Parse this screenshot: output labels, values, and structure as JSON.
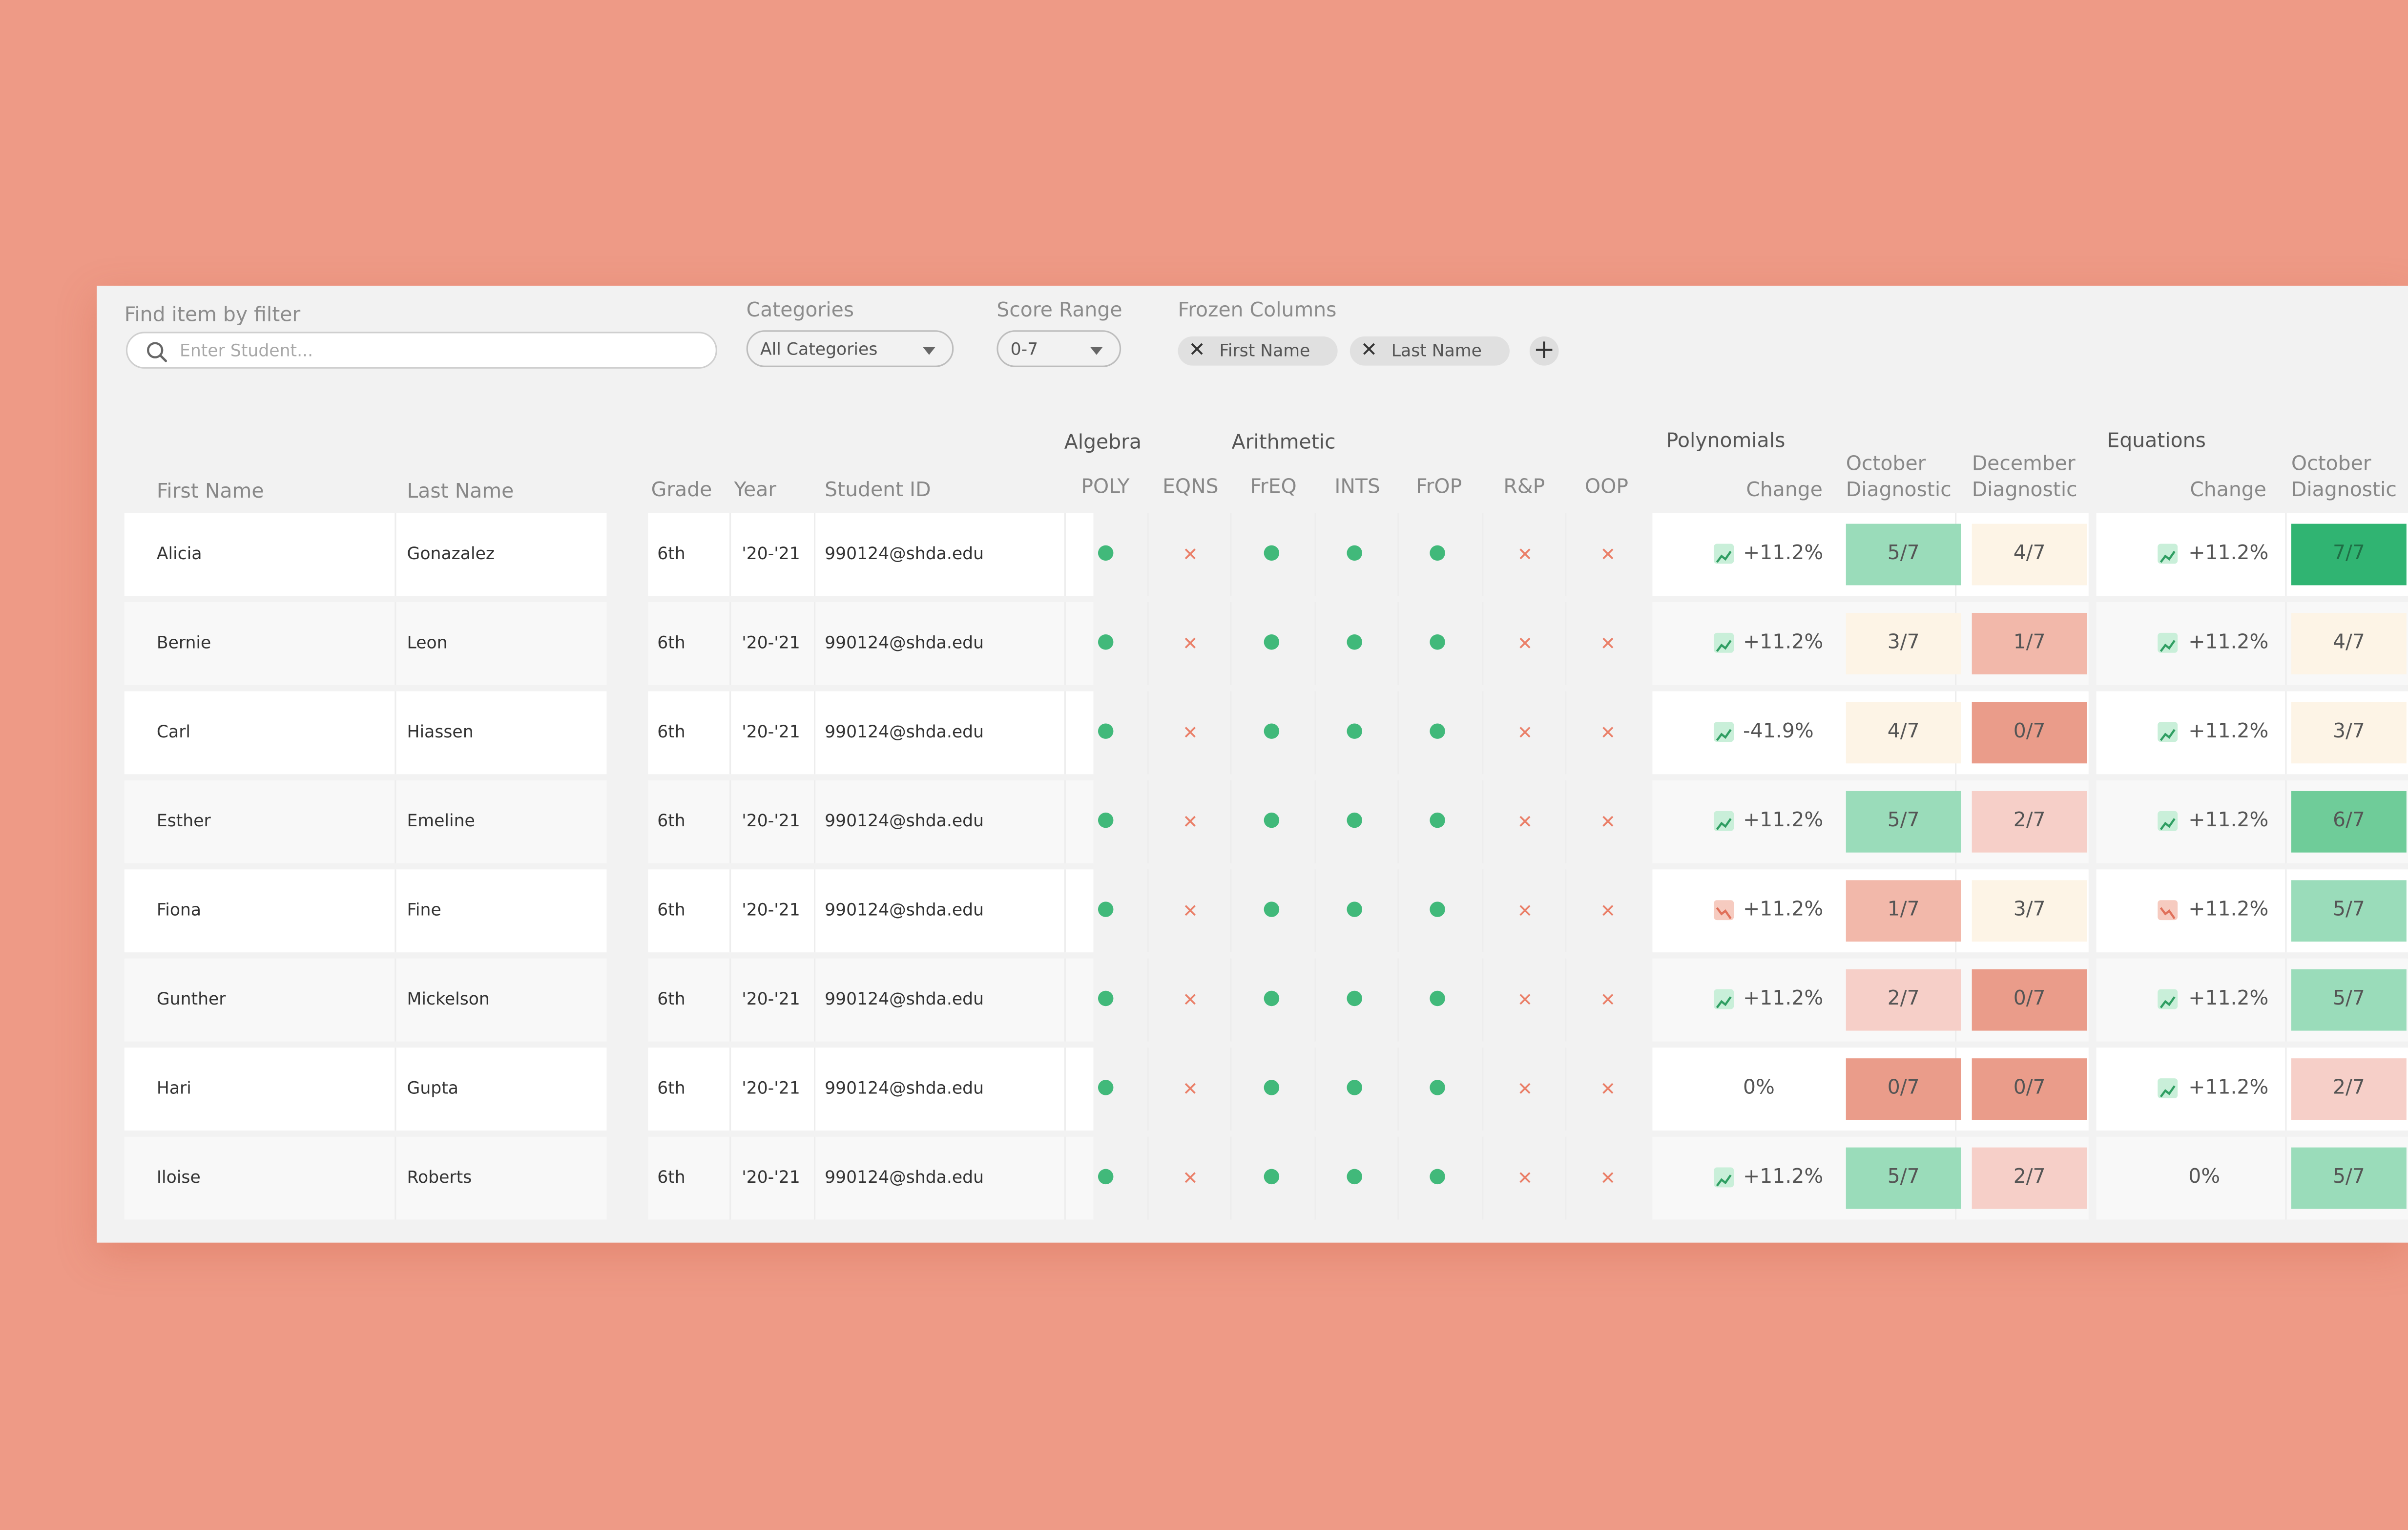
{
  "filters": {
    "search_label": "Find item by filter",
    "search_placeholder": "Enter Student...",
    "categories_label": "Categories",
    "categories_value": "All Categories",
    "score_range_label": "Score Range",
    "score_range_value": "0-7",
    "frozen_label": "Frozen Columns",
    "frozen_chips": [
      "First Name",
      "Last Name"
    ],
    "chip_remove_glyph": "✕",
    "add_glyph": "+"
  },
  "headers": {
    "first_name": "First Name",
    "last_name": "Last Name",
    "grade": "Grade",
    "year": "Year",
    "student_id": "Student ID",
    "group_algebra": "Algebra",
    "group_arithmetic": "Arithmetic",
    "skills": [
      "POLY",
      "EQNS",
      "FrEQ",
      "INTS",
      "FrOP",
      "R&P",
      "OOP"
    ],
    "group_polynomials": "Polynomials",
    "group_equations": "Equations",
    "change": "Change",
    "oct_line1": "October",
    "oct_line2": "Diagnostic",
    "dec_line1": "December",
    "dec_line2": "Diagnostic"
  },
  "glyphs": {
    "miss": "✕"
  },
  "colors": {
    "dot_green": "#41b97a",
    "miss_red": "#ea7f68",
    "trend_up_bg": "#c9efd9",
    "trend_up_line": "#2f9e62",
    "trend_down_bg": "#f6cbc0",
    "trend_down_line": "#e0705a",
    "score_0_7": "#ea9c8a",
    "score_1_7": "#f2b8aa",
    "score_2_7": "#f6cfc8",
    "score_3_7": "#fdf4e6",
    "score_4_7": "#fdf4e6",
    "score_5_7": "#9adcba",
    "score_6_7": "#6fcc99",
    "score_7_7": "#30b472"
  },
  "rows": [
    {
      "first": "Alicia",
      "last": "Gonazalez",
      "grade": "6th",
      "year": "'20-'21",
      "id": "990124@shda.edu",
      "skills": [
        1,
        0,
        1,
        1,
        1,
        0,
        0
      ],
      "poly_trend": "up",
      "poly_change": "+11.2%",
      "poly_oct": "5/7",
      "poly_dec": "4/7",
      "eq_trend": "up",
      "eq_change": "+11.2%",
      "eq_oct": "7/7"
    },
    {
      "first": "Bernie",
      "last": "Leon",
      "grade": "6th",
      "year": "'20-'21",
      "id": "990124@shda.edu",
      "skills": [
        1,
        0,
        1,
        1,
        1,
        0,
        0
      ],
      "poly_trend": "up",
      "poly_change": "+11.2%",
      "poly_oct": "3/7",
      "poly_dec": "1/7",
      "eq_trend": "up",
      "eq_change": "+11.2%",
      "eq_oct": "4/7"
    },
    {
      "first": "Carl",
      "last": "Hiassen",
      "grade": "6th",
      "year": "'20-'21",
      "id": "990124@shda.edu",
      "skills": [
        1,
        0,
        1,
        1,
        1,
        0,
        0
      ],
      "poly_trend": "up",
      "poly_change": "-41.9%",
      "poly_oct": "4/7",
      "poly_dec": "0/7",
      "eq_trend": "up",
      "eq_change": "+11.2%",
      "eq_oct": "3/7"
    },
    {
      "first": "Esther",
      "last": "Emeline",
      "grade": "6th",
      "year": "'20-'21",
      "id": "990124@shda.edu",
      "skills": [
        1,
        0,
        1,
        1,
        1,
        0,
        0
      ],
      "poly_trend": "up",
      "poly_change": "+11.2%",
      "poly_oct": "5/7",
      "poly_dec": "2/7",
      "eq_trend": "up",
      "eq_change": "+11.2%",
      "eq_oct": "6/7"
    },
    {
      "first": "Fiona",
      "last": "Fine",
      "grade": "6th",
      "year": "'20-'21",
      "id": "990124@shda.edu",
      "skills": [
        1,
        0,
        1,
        1,
        1,
        0,
        0
      ],
      "poly_trend": "down",
      "poly_change": "+11.2%",
      "poly_oct": "1/7",
      "poly_dec": "3/7",
      "eq_trend": "down",
      "eq_change": "+11.2%",
      "eq_oct": "5/7"
    },
    {
      "first": "Gunther",
      "last": "Mickelson",
      "grade": "6th",
      "year": "'20-'21",
      "id": "990124@shda.edu",
      "skills": [
        1,
        0,
        1,
        1,
        1,
        0,
        0
      ],
      "poly_trend": "up",
      "poly_change": "+11.2%",
      "poly_oct": "2/7",
      "poly_dec": "0/7",
      "eq_trend": "up",
      "eq_change": "+11.2%",
      "eq_oct": "5/7"
    },
    {
      "first": "Hari",
      "last": "Gupta",
      "grade": "6th",
      "year": "'20-'21",
      "id": "990124@shda.edu",
      "skills": [
        1,
        0,
        1,
        1,
        1,
        0,
        0
      ],
      "poly_trend": "none",
      "poly_change": "0%",
      "poly_oct": "0/7",
      "poly_dec": "0/7",
      "eq_trend": "up",
      "eq_change": "+11.2%",
      "eq_oct": "2/7"
    },
    {
      "first": "Iloise",
      "last": "Roberts",
      "grade": "6th",
      "year": "'20-'21",
      "id": "990124@shda.edu",
      "skills": [
        1,
        0,
        1,
        1,
        1,
        0,
        0
      ],
      "poly_trend": "up",
      "poly_change": "+11.2%",
      "poly_oct": "5/7",
      "poly_dec": "2/7",
      "eq_trend": "none",
      "eq_change": "0%",
      "eq_oct": "5/7"
    }
  ]
}
